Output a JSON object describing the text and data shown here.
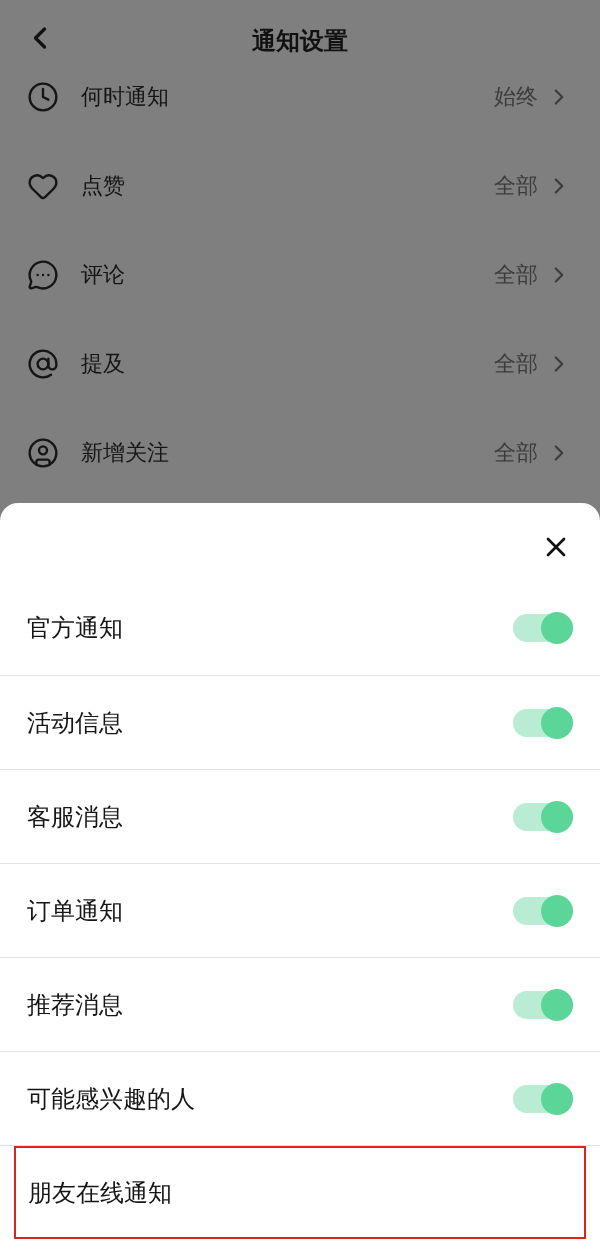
{
  "header": {
    "title": "通知设置"
  },
  "settings": [
    {
      "label": "何时通知",
      "value": "始终"
    },
    {
      "label": "点赞",
      "value": "全部"
    },
    {
      "label": "评论",
      "value": "全部"
    },
    {
      "label": "提及",
      "value": "全部"
    },
    {
      "label": "新增关注",
      "value": "全部"
    }
  ],
  "sheet": {
    "items": [
      {
        "label": "官方通知",
        "kind": "toggle",
        "on": true,
        "highlighted": false
      },
      {
        "label": "活动信息",
        "kind": "toggle",
        "on": true,
        "highlighted": false
      },
      {
        "label": "客服消息",
        "kind": "toggle",
        "on": true,
        "highlighted": false
      },
      {
        "label": "订单通知",
        "kind": "toggle",
        "on": true,
        "highlighted": false
      },
      {
        "label": "推荐消息",
        "kind": "toggle",
        "on": true,
        "highlighted": false
      },
      {
        "label": "可能感兴趣的人",
        "kind": "toggle",
        "on": true,
        "highlighted": false
      },
      {
        "label": "朋友在线通知",
        "kind": "plain",
        "highlighted": true
      }
    ]
  }
}
